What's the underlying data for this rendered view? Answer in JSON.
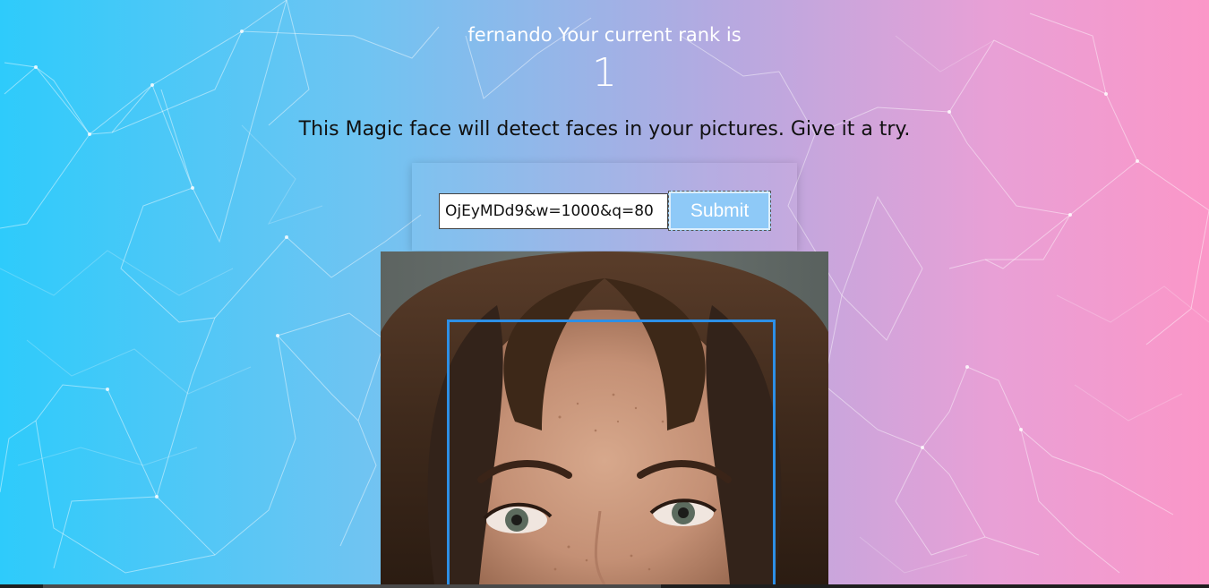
{
  "header": {
    "greeting": "fernando Your current rank is",
    "rank": "1"
  },
  "intro": {
    "tagline": "This Magic face will detect faces in your pictures. Give it a try."
  },
  "form": {
    "url_value": "OjEyMDd9&w=1000&q=80",
    "submit_label": "Submit"
  },
  "result": {
    "image_alt": "portrait photo with detected face",
    "box_color": "#2d8fe6"
  },
  "colors": {
    "gradient_left": "#2ecbfb",
    "gradient_right": "#fb97c8",
    "button": "#8ec9f7"
  }
}
